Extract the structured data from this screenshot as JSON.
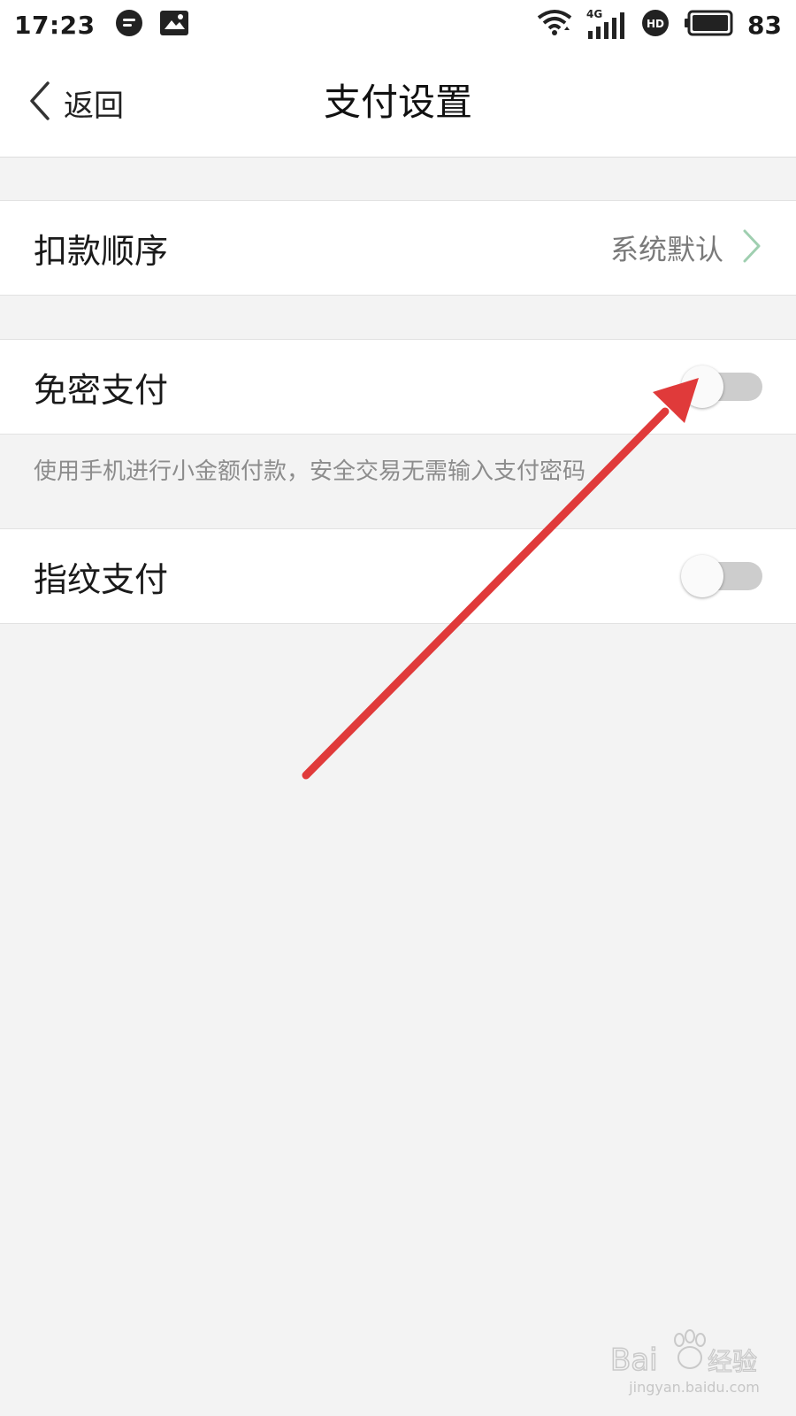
{
  "status_bar": {
    "time": "17:23",
    "network_type": "4G",
    "battery_level": "83",
    "left_icons": [
      "message-icon",
      "image-icon"
    ],
    "right_icons": [
      "wifi-icon",
      "signal-icon",
      "hd-icon",
      "battery-icon"
    ]
  },
  "header": {
    "back_label": "返回",
    "title": "支付设置"
  },
  "settings": {
    "deduction_order": {
      "label": "扣款顺序",
      "value": "系统默认"
    },
    "password_free_payment": {
      "label": "免密支付",
      "enabled": false,
      "hint": "使用手机进行小金额付款，安全交易无需输入支付密码"
    },
    "fingerprint_payment": {
      "label": "指纹支付",
      "enabled": false
    }
  },
  "colors": {
    "background": "#f3f3f3",
    "row_background": "#ffffff",
    "toggle_off_track": "#cdcdcd",
    "annotation_arrow": "#e03a3a",
    "chevron": "#9fcfb0"
  },
  "watermark": {
    "brand": "Baidu经验",
    "url": "jingyan.baidu.com"
  }
}
